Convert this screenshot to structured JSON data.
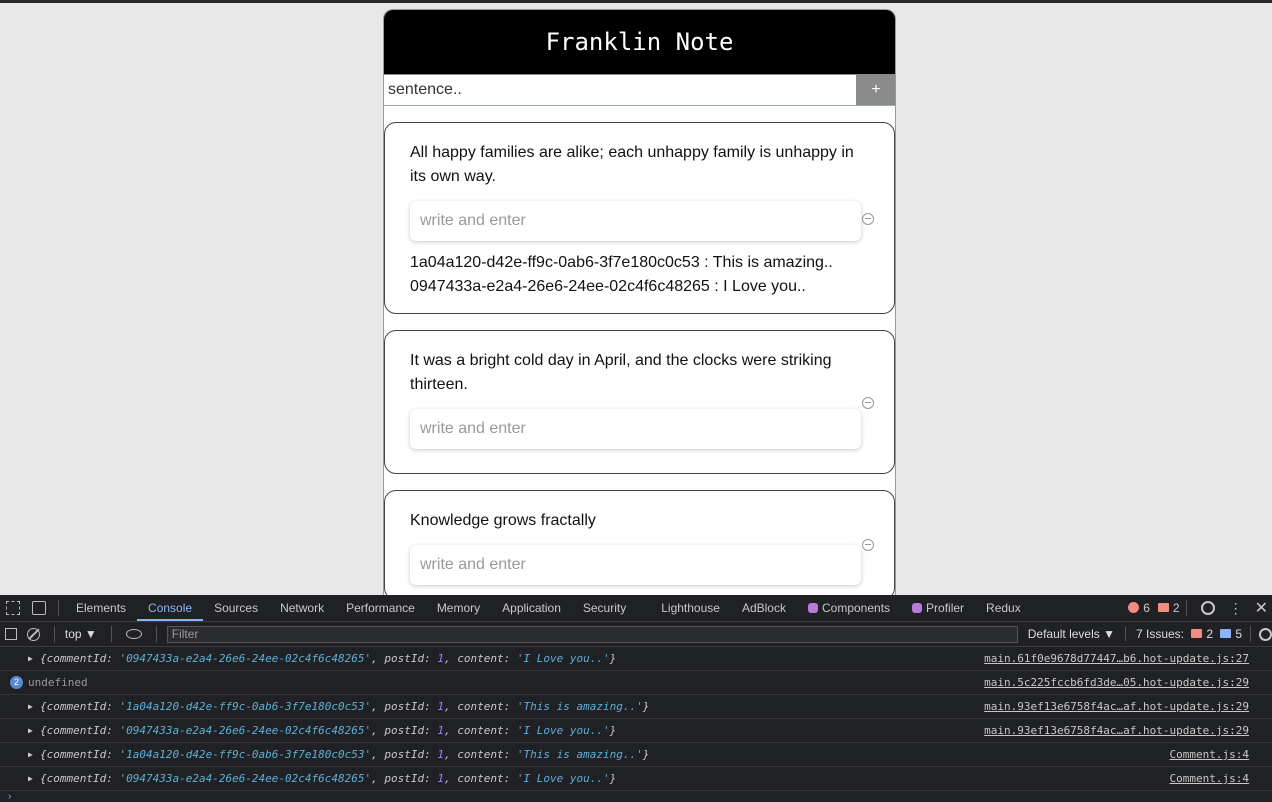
{
  "app": {
    "title": "Franklin Note",
    "new_post": {
      "placeholder": "sentence..",
      "add_label": "+"
    },
    "comment_placeholder": "write and enter",
    "posts": [
      {
        "text": "All happy families are alike; each unhappy family is unhappy in its own way.",
        "comments": [
          "1a04a120-d42e-ff9c-0ab6-3f7e180c0c53 : This is amazing..",
          "0947433a-e2a4-26e6-24ee-02c4f6c48265 : I Love you.."
        ]
      },
      {
        "text": "It was a bright cold day in April, and the clocks were striking thirteen.",
        "comments": []
      },
      {
        "text": "Knowledge grows fractally",
        "comments": []
      }
    ]
  },
  "devtools": {
    "tabs": [
      "Elements",
      "Console",
      "Sources",
      "Network",
      "Performance",
      "Memory",
      "Application",
      "Security",
      "Lighthouse",
      "AdBlock",
      "Components",
      "Profiler",
      "Redux"
    ],
    "active_tab": "Console",
    "errors_count": "6",
    "warnings_count": "2",
    "context": "top ▼",
    "filter_placeholder": "Filter",
    "levels": "Default levels ▼",
    "issues_label": "7 Issues:",
    "issues_errors": "2",
    "issues_info": "5",
    "log": [
      {
        "caret": "▶",
        "commentId": "'0947433a-e2a4-26e6-24ee-02c4f6c48265'",
        "postId": "1",
        "content": "'I Love you..'",
        "source": "main.61f0e9678d77447…b6.hot-update.js:27"
      },
      {
        "count": "2",
        "plain": "undefined",
        "source": "main.5c225fccb6fd3de…05.hot-update.js:29"
      },
      {
        "caret": "▶",
        "commentId": "'1a04a120-d42e-ff9c-0ab6-3f7e180c0c53'",
        "postId": "1",
        "content": "'This is amazing..'",
        "source": "main.93ef13e6758f4ac…af.hot-update.js:29"
      },
      {
        "caret": "▶",
        "commentId": "'0947433a-e2a4-26e6-24ee-02c4f6c48265'",
        "postId": "1",
        "content": "'I Love you..'",
        "source": "main.93ef13e6758f4ac…af.hot-update.js:29"
      },
      {
        "caret": "▶",
        "commentId": "'1a04a120-d42e-ff9c-0ab6-3f7e180c0c53'",
        "postId": "1",
        "content": "'This is amazing..'",
        "source": "Comment.js:4"
      },
      {
        "caret": "▶",
        "commentId": "'0947433a-e2a4-26e6-24ee-02c4f6c48265'",
        "postId": "1",
        "content": "'I Love you..'",
        "source": "Comment.js:4"
      }
    ],
    "prompt": "›"
  }
}
